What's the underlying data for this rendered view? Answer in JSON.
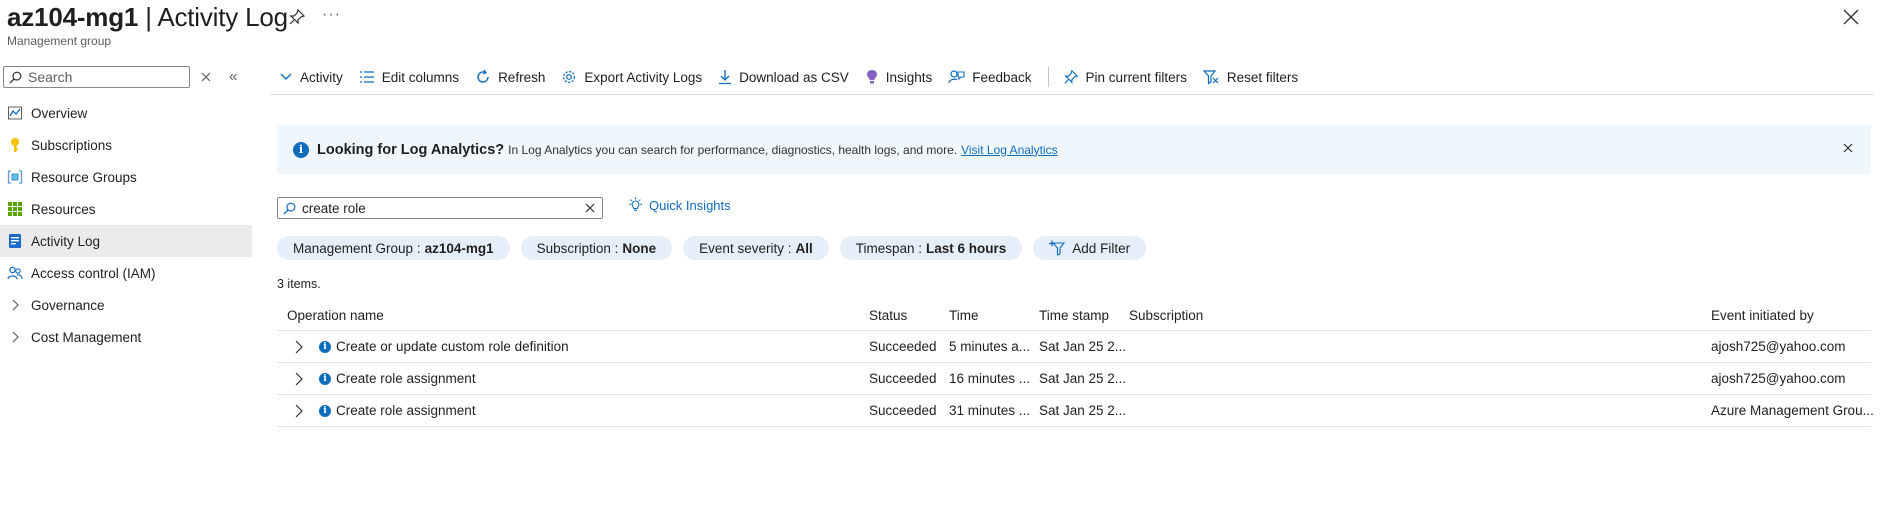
{
  "header": {
    "title_bold": "az104-mg1",
    "title_rest": " | Activity Log",
    "subtitle": "Management group",
    "more_glyph": "···"
  },
  "sidebar": {
    "search_placeholder": "Search",
    "collapse_glyph": "«",
    "items": [
      {
        "label": "Overview",
        "icon": "overview-icon"
      },
      {
        "label": "Subscriptions",
        "icon": "key-icon"
      },
      {
        "label": "Resource Groups",
        "icon": "resource-group-icon"
      },
      {
        "label": "Resources",
        "icon": "grid-icon"
      },
      {
        "label": "Activity Log",
        "icon": "activity-log-icon",
        "active": true
      },
      {
        "label": "Access control (IAM)",
        "icon": "people-icon"
      },
      {
        "label": "Governance",
        "icon": "chevron-right-icon"
      },
      {
        "label": "Cost Management",
        "icon": "chevron-right-icon"
      }
    ]
  },
  "toolbar": {
    "activity": "Activity",
    "edit_columns": "Edit columns",
    "refresh": "Refresh",
    "export": "Export Activity Logs",
    "download_csv": "Download as CSV",
    "insights": "Insights",
    "feedback": "Feedback",
    "pin_filters": "Pin current filters",
    "reset_filters": "Reset filters"
  },
  "banner": {
    "title": "Looking for Log Analytics?",
    "text": "In Log Analytics you can search for performance, diagnostics, health logs, and more.",
    "link": "Visit Log Analytics"
  },
  "filter": {
    "search_value": "create role",
    "quick_insights": "Quick Insights"
  },
  "pills": {
    "mg_label": "Management Group :",
    "mg_value": "az104-mg1",
    "sub_label": "Subscription :",
    "sub_value": "None",
    "sev_label": "Event severity :",
    "sev_value": "All",
    "ts_label": "Timespan :",
    "ts_value": "Last 6 hours",
    "add_filter": "Add Filter"
  },
  "items_count": "3 items.",
  "table": {
    "columns": {
      "operation": "Operation name",
      "status": "Status",
      "time": "Time",
      "timestamp": "Time stamp",
      "subscription": "Subscription",
      "initiated_by": "Event initiated by"
    },
    "rows": [
      {
        "operation": "Create or update custom role definition",
        "status": "Succeeded",
        "time": "5 minutes a...",
        "timestamp": "Sat Jan 25 2...",
        "subscription": "",
        "initiated_by": "ajosh725@yahoo.com"
      },
      {
        "operation": "Create role assignment",
        "status": "Succeeded",
        "time": "16 minutes ...",
        "timestamp": "Sat Jan 25 2...",
        "subscription": "",
        "initiated_by": "ajosh725@yahoo.com"
      },
      {
        "operation": "Create role assignment",
        "status": "Succeeded",
        "time": "31 minutes ...",
        "timestamp": "Sat Jan 25 2...",
        "subscription": "",
        "initiated_by": "Azure Management Grou..."
      }
    ]
  },
  "colors": {
    "accent": "#0f6cbd",
    "banner_bg": "#eff6fc",
    "pill_bg": "#e5effa",
    "active_nav": "#edebe9"
  }
}
